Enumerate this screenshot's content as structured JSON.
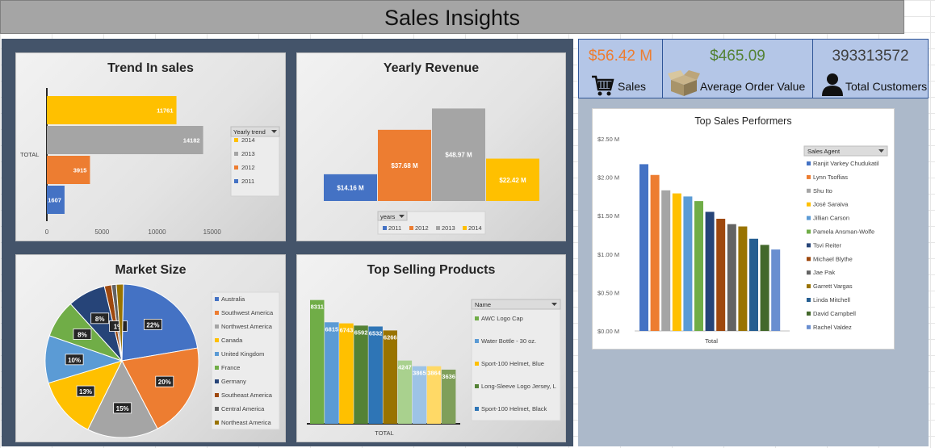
{
  "title": "Sales Insights",
  "kpis": {
    "sales": {
      "value": "$56.42 M",
      "label": "Sales",
      "icon": "shopping-cart-icon",
      "color": "#ed7d31"
    },
    "aov": {
      "value": "$465.09",
      "label": "Average Order Value",
      "icon": "open-box-icon",
      "color": "#548235"
    },
    "customers": {
      "value": "393313572",
      "label": "Total Customers",
      "icon": "person-icon",
      "color": "#404040"
    }
  },
  "charts": {
    "trend": {
      "title": "Trend In sales"
    },
    "yearly": {
      "title": "Yearly Revenue"
    },
    "market": {
      "title": "Market Size"
    },
    "products": {
      "title": "Top Selling Products"
    },
    "performers": {
      "title": "Top Sales Performers"
    }
  },
  "chart_data": [
    {
      "id": "trend",
      "type": "bar",
      "title": "Trend In sales",
      "orientation": "horizontal",
      "category_label": "TOTAL",
      "legend_title": "Yearly trend",
      "series": [
        {
          "name": "2014",
          "value": 11761,
          "color": "#ffc000"
        },
        {
          "name": "2013",
          "value": 14182,
          "color": "#a5a5a5"
        },
        {
          "name": "2012",
          "value": 3915,
          "color": "#ed7d31"
        },
        {
          "name": "2011",
          "value": 1607,
          "color": "#4472c4"
        }
      ],
      "x_ticks": [
        "0",
        "5000",
        "10000",
        "15000"
      ],
      "xlim": [
        0,
        15000
      ]
    },
    {
      "id": "yearly",
      "type": "bar",
      "title": "Yearly Revenue",
      "legend_title": "years",
      "series": [
        {
          "name": "2011",
          "value": 14.16,
          "label": "$14.16 M",
          "color": "#4472c4"
        },
        {
          "name": "2012",
          "value": 37.68,
          "label": "$37.68 M",
          "color": "#ed7d31"
        },
        {
          "name": "2013",
          "value": 48.97,
          "label": "$48.97 M",
          "color": "#a5a5a5"
        },
        {
          "name": "2014",
          "value": 22.42,
          "label": "$22.42 M",
          "color": "#ffc000"
        }
      ]
    },
    {
      "id": "market",
      "type": "pie",
      "title": "Market Size",
      "slices": [
        {
          "name": "Australia",
          "value": 22,
          "label": "22%",
          "color": "#4472c4"
        },
        {
          "name": "Southwest America",
          "value": 20,
          "label": "20%",
          "color": "#ed7d31"
        },
        {
          "name": "Northwest America",
          "value": 15,
          "label": "15%",
          "color": "#a5a5a5"
        },
        {
          "name": "Canada",
          "value": 13,
          "label": "13%",
          "color": "#ffc000"
        },
        {
          "name": "United Kingdom",
          "value": 10,
          "label": "10%",
          "color": "#5b9bd5"
        },
        {
          "name": "France",
          "value": 8,
          "label": "8%",
          "color": "#70ad47"
        },
        {
          "name": "Germany",
          "value": 8,
          "label": "8%",
          "color": "#264478"
        },
        {
          "name": "Southeast America",
          "value": 1.5,
          "label": "",
          "color": "#9e480e"
        },
        {
          "name": "Central America",
          "value": 1,
          "label": "1%",
          "color": "#636363"
        },
        {
          "name": "Northeast America",
          "value": 1.5,
          "label": "",
          "color": "#997300"
        }
      ]
    },
    {
      "id": "products",
      "type": "bar",
      "title": "Top Selling Products",
      "category_label": "TOTAL",
      "legend_title": "Name",
      "legend": [
        {
          "name": "AWC Logo Cap",
          "color": "#70ad47"
        },
        {
          "name": "Water Bottle - 30 oz.",
          "color": "#5b9bd5"
        },
        {
          "name": "Sport-100 Helmet, Blue",
          "color": "#ffc000"
        },
        {
          "name": "Long-Sleeve Logo Jersey, L",
          "color": "#548235"
        },
        {
          "name": "Sport-100 Helmet, Black",
          "color": "#2e75b6"
        }
      ],
      "bars": [
        {
          "value": 8311,
          "label": "8311",
          "color": "#70ad47"
        },
        {
          "value": 6815,
          "label": "6815",
          "color": "#5b9bd5"
        },
        {
          "value": 6743,
          "label": "6743",
          "color": "#ffc000"
        },
        {
          "value": 6592,
          "label": "6592",
          "color": "#548235"
        },
        {
          "value": 6532,
          "label": "6532",
          "color": "#2e75b6"
        },
        {
          "value": 6266,
          "label": "6266",
          "color": "#997300"
        },
        {
          "value": 4247,
          "label": "4247",
          "color": "#a9d18e"
        },
        {
          "value": 3865,
          "label": "3865",
          "color": "#9dc3e6"
        },
        {
          "value": 3864,
          "label": "3864",
          "color": "#ffd966"
        },
        {
          "value": 3636,
          "label": "3636",
          "color": "#7f9f5a"
        }
      ],
      "ymax": 9000
    },
    {
      "id": "performers",
      "type": "bar",
      "title": "Top Sales Performers",
      "category_label": "Total",
      "legend_title": "Sales Agent",
      "y_ticks": [
        "$0.00 M",
        "$0.50 M",
        "$1.00 M",
        "$1.50 M",
        "$2.00 M",
        "$2.50 M"
      ],
      "ylim": [
        0,
        2.5
      ],
      "series": [
        {
          "name": "Ranjit Varkey Chudukatil",
          "value": 2.17,
          "color": "#4472c4"
        },
        {
          "name": "Lynn Tsoflias",
          "value": 2.03,
          "color": "#ed7d31"
        },
        {
          "name": "Shu Ito",
          "value": 1.83,
          "color": "#a5a5a5"
        },
        {
          "name": "José Saraiva",
          "value": 1.79,
          "color": "#ffc000"
        },
        {
          "name": "Jillian Carson",
          "value": 1.75,
          "color": "#5b9bd5"
        },
        {
          "name": "Pamela Ansman-Wolfe",
          "value": 1.69,
          "color": "#70ad47"
        },
        {
          "name": "Tsvi Reiter",
          "value": 1.55,
          "color": "#264478"
        },
        {
          "name": "Michael Blythe",
          "value": 1.46,
          "color": "#9e480e"
        },
        {
          "name": "Jae Pak",
          "value": 1.39,
          "color": "#636363"
        },
        {
          "name": "Garrett Vargas",
          "value": 1.36,
          "color": "#997300"
        },
        {
          "name": "Linda Mitchell",
          "value": 1.2,
          "color": "#255e91"
        },
        {
          "name": "David Campbell",
          "value": 1.12,
          "color": "#43682b"
        },
        {
          "name": "Rachel Valdez",
          "value": 1.06,
          "color": "#698ed0"
        }
      ]
    }
  ]
}
